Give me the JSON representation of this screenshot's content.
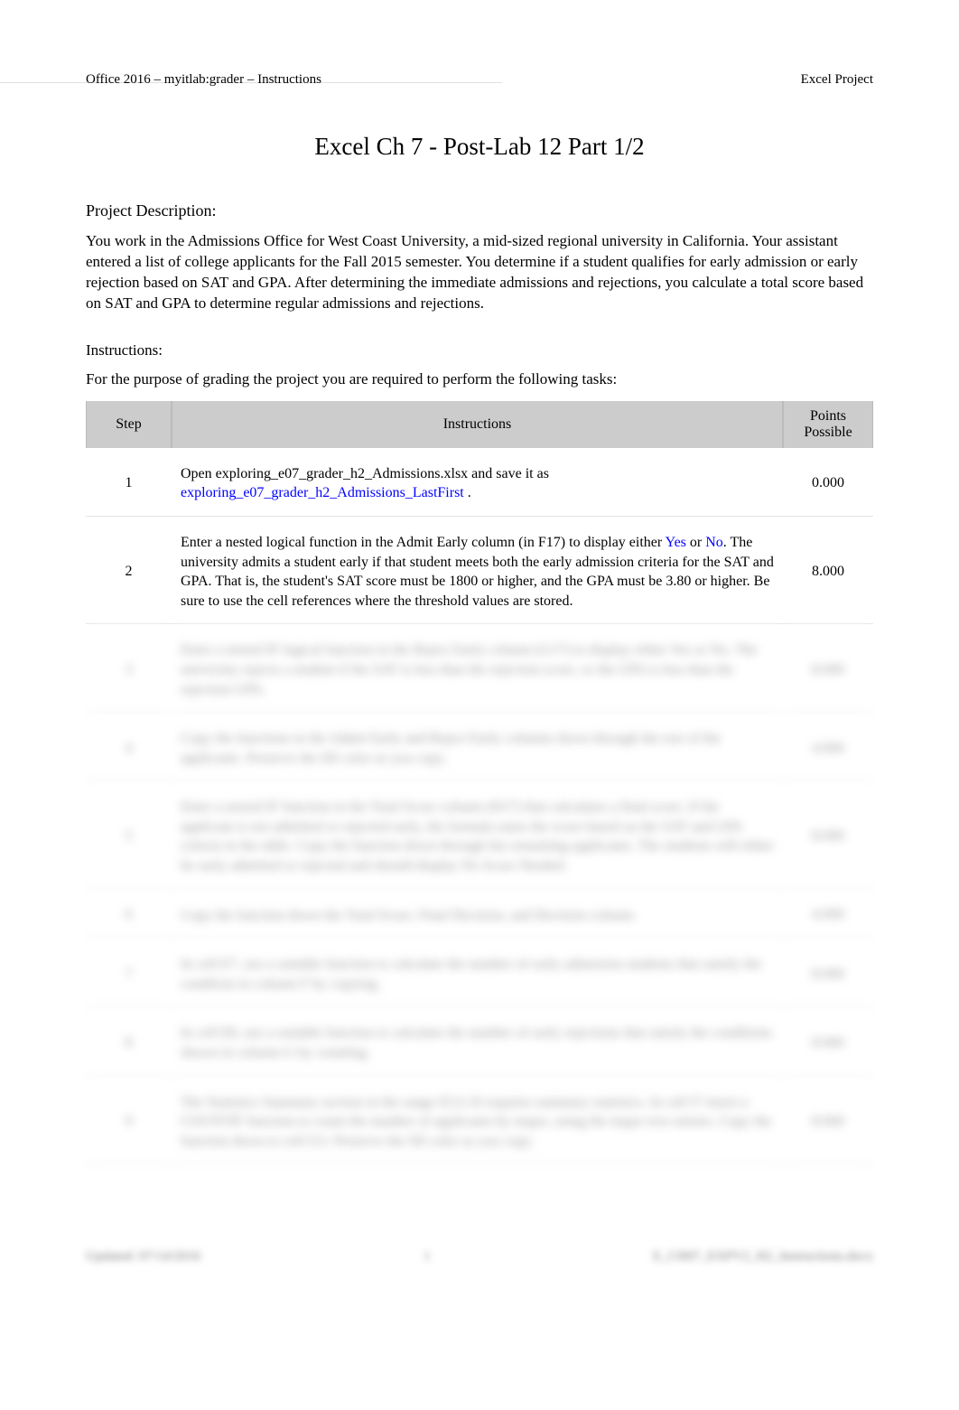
{
  "header": {
    "left": "Office 2016 – myitlab:grader – Instructions",
    "right": "Excel Project"
  },
  "title": "Excel Ch 7 - Post-Lab 12 Part 1/2",
  "project_description_label": "Project Description:",
  "project_description": "You work in the Admissions Office for West Coast University, a mid-sized regional university in California. Your assistant entered a list of college applicants for the Fall 2015 semester. You determine if a student qualifies for early admission or early rejection based on SAT and GPA. After determining the immediate admissions and rejections, you calculate a total score based on SAT and GPA to determine regular admissions and rejections.",
  "instructions_label": "Instructions:",
  "grading_note": "For the purpose of grading the project you are required to perform the following tasks:",
  "table": {
    "headers": {
      "step": "Step",
      "instructions": "Instructions",
      "points": "Points Possible"
    },
    "rows": [
      {
        "step": "1",
        "instruction_parts": [
          {
            "text": "Open exploring_e07_grader_h2_Admissions.xlsx and save it as ",
            "blue": false
          },
          {
            "text": "exploring_e07_grader_h2_Admissions_LastFirst",
            "blue": true
          },
          {
            "text": "   .",
            "blue": false
          }
        ],
        "points": "0.000"
      },
      {
        "step": "2",
        "instruction_parts": [
          {
            "text": "Enter a nested logical function in the Admit Early column (in F17) to display either ",
            "blue": false
          },
          {
            "text": "Yes",
            "blue": true
          },
          {
            "text": " or ",
            "blue": false
          },
          {
            "text": "No",
            "blue": true
          },
          {
            "text": ". The university admits a student early if that student meets both the early admission criteria for the SAT and GPA. That is, the student's SAT score must be 1800 or higher, and the GPA must be 3.80 or higher. Be sure to use the cell references where the threshold values are stored.",
            "blue": false
          }
        ],
        "points": "8.000"
      }
    ],
    "blurred_rows": [
      {
        "step": "3",
        "text": "Enter a nested IF logical function in the Reject Early column (G17) to display either Yes or No. The university rejects a student if the SAT is less than the rejection score, or the GPA is less than the rejection GPA.",
        "points": "8.000"
      },
      {
        "step": "4",
        "text": "Copy the functions in the Admit Early and Reject Early columns down through the rest of the applicants. Preserve the fill color as you copy.",
        "points": "4.000"
      },
      {
        "step": "5",
        "text": "Enter a nested IF function in the Total Score column (H17) that calculates a final score. If the applicant is not admitted or rejected early, the formula sums the score based on the SAT and GPA criteria in the table. Copy the function down through the remaining applicants. The students will either be early admitted or rejected and should display No Score Needed.",
        "points": "8.000"
      },
      {
        "step": "6",
        "text": "Copy the function down the Total Score, Final Decision, and Decision column.",
        "points": "4.000"
      },
      {
        "step": "7",
        "text": "In cell E7, use a suitable function to calculate the number of early admission students that satisfy the condition in column F by copying.",
        "points": "8.000"
      },
      {
        "step": "8",
        "text": "In cell E8, use a suitable function to calculate the number of early rejections that satisfy the conditions shown in column G by counting.",
        "points": "8.000"
      },
      {
        "step": "9",
        "text": "The Statistics Summary section in the range E5:L10 requires summary statistics. In cell I7 insert a COUNTIF function to count the number of applicants by major, using the major text entries. Copy the function down to cell I13. Preserve the fill color as you copy.",
        "points": "8.000"
      }
    ]
  },
  "footer": {
    "left": "Updated: 07/14/2016",
    "center": "1",
    "right": "E_CH07_EXPV2_H2_Instructions.docx"
  }
}
